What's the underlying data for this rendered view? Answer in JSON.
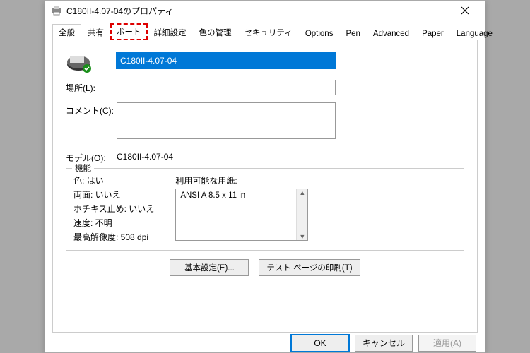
{
  "window": {
    "title": "C180II-4.07-04のプロパティ"
  },
  "tabs": {
    "general": "全般",
    "share": "共有",
    "port": "ポート",
    "advanced": "詳細設定",
    "color": "色の管理",
    "security": "セキュリティ",
    "options": "Options",
    "pen": "Pen",
    "advanced2": "Advanced",
    "paper": "Paper",
    "language": "Language"
  },
  "fields": {
    "printer_name": "C180II-4.07-04",
    "location_label": "場所(L):",
    "location_value": "",
    "comment_label": "コメント(C):",
    "comment_value": "",
    "model_label": "モデル(O):",
    "model_value": "C180II-4.07-04"
  },
  "features": {
    "legend": "機能",
    "color": "色: はい",
    "duplex": "両面: いいえ",
    "staple": "ホチキス止め: いいえ",
    "speed": "速度: 不明",
    "resolution": "最高解像度: 508 dpi",
    "paper_label": "利用可能な用紙:",
    "paper_item": "ANSI A 8.5 x 11 in"
  },
  "buttons": {
    "prefs": "基本設定(E)...",
    "testpage": "テスト ページの印刷(T)",
    "ok": "OK",
    "cancel": "キャンセル",
    "apply": "適用(A)"
  }
}
